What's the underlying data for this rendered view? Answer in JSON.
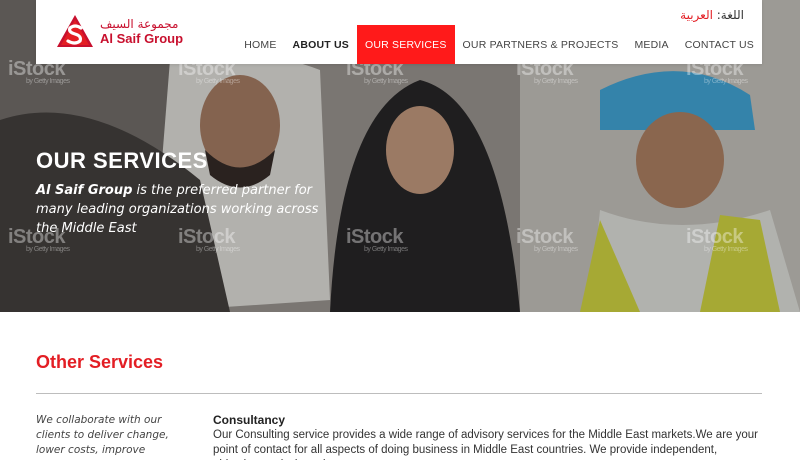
{
  "header": {
    "logo": {
      "arabic_name": "مجموعة السيف",
      "english_name": "Al Saif Group"
    },
    "language": {
      "label": "اللغة:",
      "value": "العربية"
    },
    "nav": [
      {
        "label": "HOME",
        "state": "normal"
      },
      {
        "label": "ABOUT US",
        "state": "bold"
      },
      {
        "label": "OUR SERVICES",
        "state": "active"
      },
      {
        "label": "OUR PARTNERS & PROJECTS",
        "state": "normal"
      },
      {
        "label": "MEDIA",
        "state": "normal"
      },
      {
        "label": "CONTACT US",
        "state": "normal"
      }
    ]
  },
  "hero": {
    "title": "OUR SERVICES",
    "subtitle_brand": "Al Saif Group",
    "subtitle_rest": " is the preferred partner for many leading organizations working across the Middle East",
    "watermark_brand": "iStock",
    "watermark_sub": "by Getty Images"
  },
  "main": {
    "section_title": "Other Services",
    "side_text": "We collaborate with our clients to deliver change, lower costs, improve efficiencies, reduce",
    "service": {
      "title": "Consultancy",
      "text": "Our Consulting service provides a wide range of advisory services for the Middle East markets.We are your point of contact for all aspects of doing business in Middle East countries. We provide independent, objective analysis and"
    }
  },
  "colors": {
    "brand_red": "#e31e24",
    "nav_active_bg": "#ff1a1a"
  }
}
